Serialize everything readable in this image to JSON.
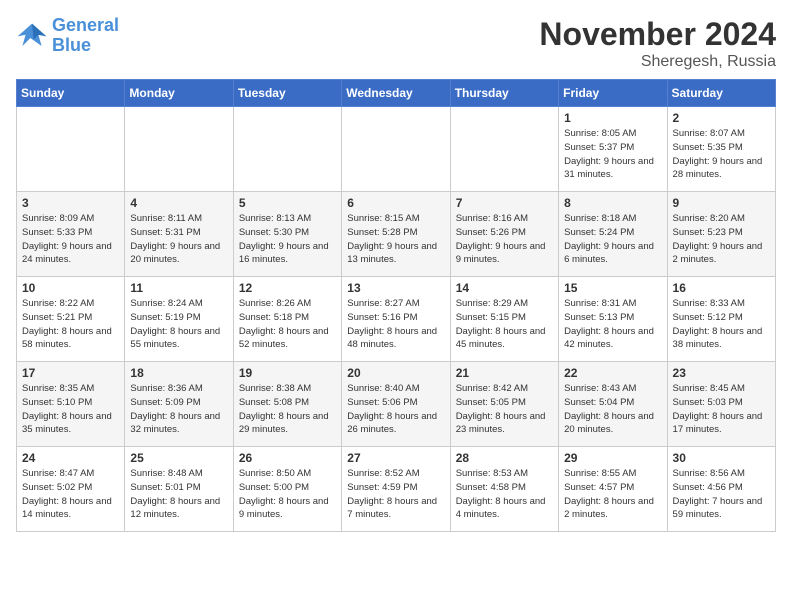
{
  "logo": {
    "line1": "General",
    "line2": "Blue"
  },
  "title": "November 2024",
  "location": "Sheregesh, Russia",
  "days_of_week": [
    "Sunday",
    "Monday",
    "Tuesday",
    "Wednesday",
    "Thursday",
    "Friday",
    "Saturday"
  ],
  "weeks": [
    [
      {
        "day": "",
        "info": ""
      },
      {
        "day": "",
        "info": ""
      },
      {
        "day": "",
        "info": ""
      },
      {
        "day": "",
        "info": ""
      },
      {
        "day": "",
        "info": ""
      },
      {
        "day": "1",
        "info": "Sunrise: 8:05 AM\nSunset: 5:37 PM\nDaylight: 9 hours and 31 minutes."
      },
      {
        "day": "2",
        "info": "Sunrise: 8:07 AM\nSunset: 5:35 PM\nDaylight: 9 hours and 28 minutes."
      }
    ],
    [
      {
        "day": "3",
        "info": "Sunrise: 8:09 AM\nSunset: 5:33 PM\nDaylight: 9 hours and 24 minutes."
      },
      {
        "day": "4",
        "info": "Sunrise: 8:11 AM\nSunset: 5:31 PM\nDaylight: 9 hours and 20 minutes."
      },
      {
        "day": "5",
        "info": "Sunrise: 8:13 AM\nSunset: 5:30 PM\nDaylight: 9 hours and 16 minutes."
      },
      {
        "day": "6",
        "info": "Sunrise: 8:15 AM\nSunset: 5:28 PM\nDaylight: 9 hours and 13 minutes."
      },
      {
        "day": "7",
        "info": "Sunrise: 8:16 AM\nSunset: 5:26 PM\nDaylight: 9 hours and 9 minutes."
      },
      {
        "day": "8",
        "info": "Sunrise: 8:18 AM\nSunset: 5:24 PM\nDaylight: 9 hours and 6 minutes."
      },
      {
        "day": "9",
        "info": "Sunrise: 8:20 AM\nSunset: 5:23 PM\nDaylight: 9 hours and 2 minutes."
      }
    ],
    [
      {
        "day": "10",
        "info": "Sunrise: 8:22 AM\nSunset: 5:21 PM\nDaylight: 8 hours and 58 minutes."
      },
      {
        "day": "11",
        "info": "Sunrise: 8:24 AM\nSunset: 5:19 PM\nDaylight: 8 hours and 55 minutes."
      },
      {
        "day": "12",
        "info": "Sunrise: 8:26 AM\nSunset: 5:18 PM\nDaylight: 8 hours and 52 minutes."
      },
      {
        "day": "13",
        "info": "Sunrise: 8:27 AM\nSunset: 5:16 PM\nDaylight: 8 hours and 48 minutes."
      },
      {
        "day": "14",
        "info": "Sunrise: 8:29 AM\nSunset: 5:15 PM\nDaylight: 8 hours and 45 minutes."
      },
      {
        "day": "15",
        "info": "Sunrise: 8:31 AM\nSunset: 5:13 PM\nDaylight: 8 hours and 42 minutes."
      },
      {
        "day": "16",
        "info": "Sunrise: 8:33 AM\nSunset: 5:12 PM\nDaylight: 8 hours and 38 minutes."
      }
    ],
    [
      {
        "day": "17",
        "info": "Sunrise: 8:35 AM\nSunset: 5:10 PM\nDaylight: 8 hours and 35 minutes."
      },
      {
        "day": "18",
        "info": "Sunrise: 8:36 AM\nSunset: 5:09 PM\nDaylight: 8 hours and 32 minutes."
      },
      {
        "day": "19",
        "info": "Sunrise: 8:38 AM\nSunset: 5:08 PM\nDaylight: 8 hours and 29 minutes."
      },
      {
        "day": "20",
        "info": "Sunrise: 8:40 AM\nSunset: 5:06 PM\nDaylight: 8 hours and 26 minutes."
      },
      {
        "day": "21",
        "info": "Sunrise: 8:42 AM\nSunset: 5:05 PM\nDaylight: 8 hours and 23 minutes."
      },
      {
        "day": "22",
        "info": "Sunrise: 8:43 AM\nSunset: 5:04 PM\nDaylight: 8 hours and 20 minutes."
      },
      {
        "day": "23",
        "info": "Sunrise: 8:45 AM\nSunset: 5:03 PM\nDaylight: 8 hours and 17 minutes."
      }
    ],
    [
      {
        "day": "24",
        "info": "Sunrise: 8:47 AM\nSunset: 5:02 PM\nDaylight: 8 hours and 14 minutes."
      },
      {
        "day": "25",
        "info": "Sunrise: 8:48 AM\nSunset: 5:01 PM\nDaylight: 8 hours and 12 minutes."
      },
      {
        "day": "26",
        "info": "Sunrise: 8:50 AM\nSunset: 5:00 PM\nDaylight: 8 hours and 9 minutes."
      },
      {
        "day": "27",
        "info": "Sunrise: 8:52 AM\nSunset: 4:59 PM\nDaylight: 8 hours and 7 minutes."
      },
      {
        "day": "28",
        "info": "Sunrise: 8:53 AM\nSunset: 4:58 PM\nDaylight: 8 hours and 4 minutes."
      },
      {
        "day": "29",
        "info": "Sunrise: 8:55 AM\nSunset: 4:57 PM\nDaylight: 8 hours and 2 minutes."
      },
      {
        "day": "30",
        "info": "Sunrise: 8:56 AM\nSunset: 4:56 PM\nDaylight: 7 hours and 59 minutes."
      }
    ]
  ]
}
